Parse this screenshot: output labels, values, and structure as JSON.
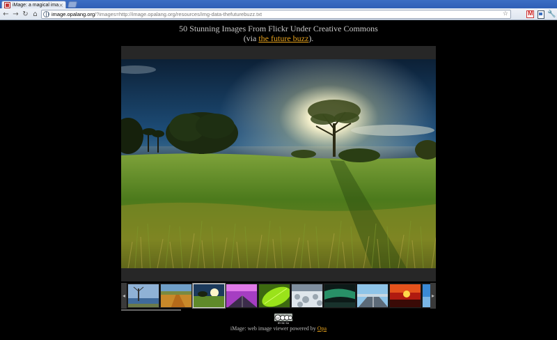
{
  "browser": {
    "tab_title": "iMage: a magical ima...",
    "tab_close": "×",
    "url_host": "image.opalang.org",
    "url_rest": "/?images=http://image.opalang.org/resources/img-data-thefuturebuzz.txt",
    "back": "←",
    "forward": "→",
    "reload": "↻",
    "home": "⌂",
    "star": "☆",
    "wrench": "🔧"
  },
  "page": {
    "title": "50 Stunning Images From Flickr Under Creative Commons",
    "subtitle_prefix": "(via ",
    "subtitle_link": "the future buzz",
    "subtitle_suffix": ").",
    "credits_prefix": "iMage: web image viewer powered by ",
    "credits_link": "Opa",
    "cc_label": "BY NC SA"
  },
  "filmstrip": {
    "left_arrow": "◂",
    "right_arrow": "▸",
    "active_index": 2
  }
}
